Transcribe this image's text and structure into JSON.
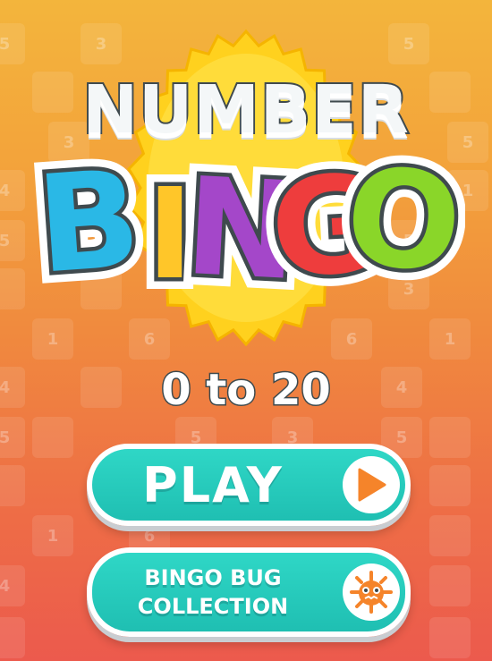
{
  "title": {
    "line1": "NUMBER",
    "line2": [
      "B",
      "I",
      "N",
      "G",
      "O"
    ]
  },
  "range_label": "0 to 20",
  "buttons": {
    "play": {
      "label": "PLAY",
      "icon": "play-arrow-icon"
    },
    "bug_collection": {
      "label_line1": "BINGO BUG",
      "label_line2": "COLLECTION",
      "icon": "bug-icon"
    }
  },
  "background_cell_numbers": [
    "5",
    "3",
    "5",
    "3",
    "5",
    "1",
    "4",
    "1",
    "5",
    "5",
    "3",
    "1",
    "6",
    "6",
    "1",
    "4",
    "4",
    "5",
    "5",
    "3",
    "5",
    "1",
    "6",
    "4"
  ],
  "colors": {
    "bg_top": "#f3b53c",
    "bg_bottom": "#ec5a4d",
    "burst": "#ffd11e",
    "button": "#22c7b8",
    "accent_orange": "#f5842a",
    "letter_b": "#2ab8e6",
    "letter_i": "#ffc629",
    "letter_n": "#a447c9",
    "letter_g": "#ee3d3d",
    "letter_o": "#8ad629"
  }
}
